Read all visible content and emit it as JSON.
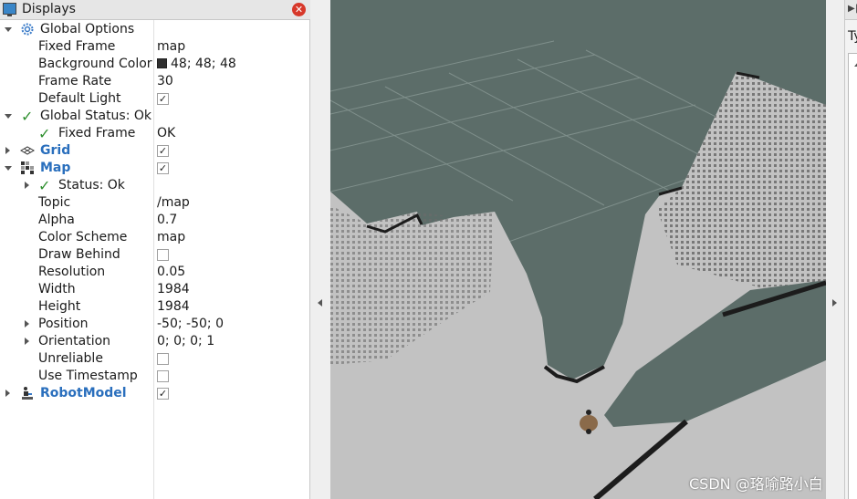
{
  "displays_panel": {
    "title": "Displays",
    "close_glyph": "✕",
    "rows": [
      {
        "label": "Global Options",
        "value": ""
      },
      {
        "label": "Fixed Frame",
        "value": "map"
      },
      {
        "label": "Background Color",
        "value": "48; 48; 48"
      },
      {
        "label": "Frame Rate",
        "value": "30"
      },
      {
        "label": "Default Light",
        "value": "✓"
      },
      {
        "label": "Global Status: Ok",
        "value": ""
      },
      {
        "label": "Fixed Frame",
        "value": "OK"
      },
      {
        "label": "Grid",
        "value": "✓"
      },
      {
        "label": "Map",
        "value": "✓"
      },
      {
        "label": "Status: Ok",
        "value": ""
      },
      {
        "label": "Topic",
        "value": "/map"
      },
      {
        "label": "Alpha",
        "value": "0.7"
      },
      {
        "label": "Color Scheme",
        "value": "map"
      },
      {
        "label": "Draw Behind",
        "value": ""
      },
      {
        "label": "Resolution",
        "value": "0.05"
      },
      {
        "label": "Width",
        "value": "1984"
      },
      {
        "label": "Height",
        "value": "1984"
      },
      {
        "label": "Position",
        "value": "-50; -50; 0"
      },
      {
        "label": "Orientation",
        "value": "0; 0; 0; 1"
      },
      {
        "label": "Unreliable",
        "value": ""
      },
      {
        "label": "Use Timestamp",
        "value": ""
      },
      {
        "label": "RobotModel",
        "value": "✓"
      }
    ],
    "check_glyph": "✓"
  },
  "right_panel": {
    "label": "Ty",
    "skip_glyph": "▶|"
  },
  "viewport": {
    "background_color": "#5c6d69",
    "map_free_color": "#c2c2c2",
    "obstacle_color": "#1c1c1c"
  },
  "watermark": "CSDN @珞喻路小白"
}
